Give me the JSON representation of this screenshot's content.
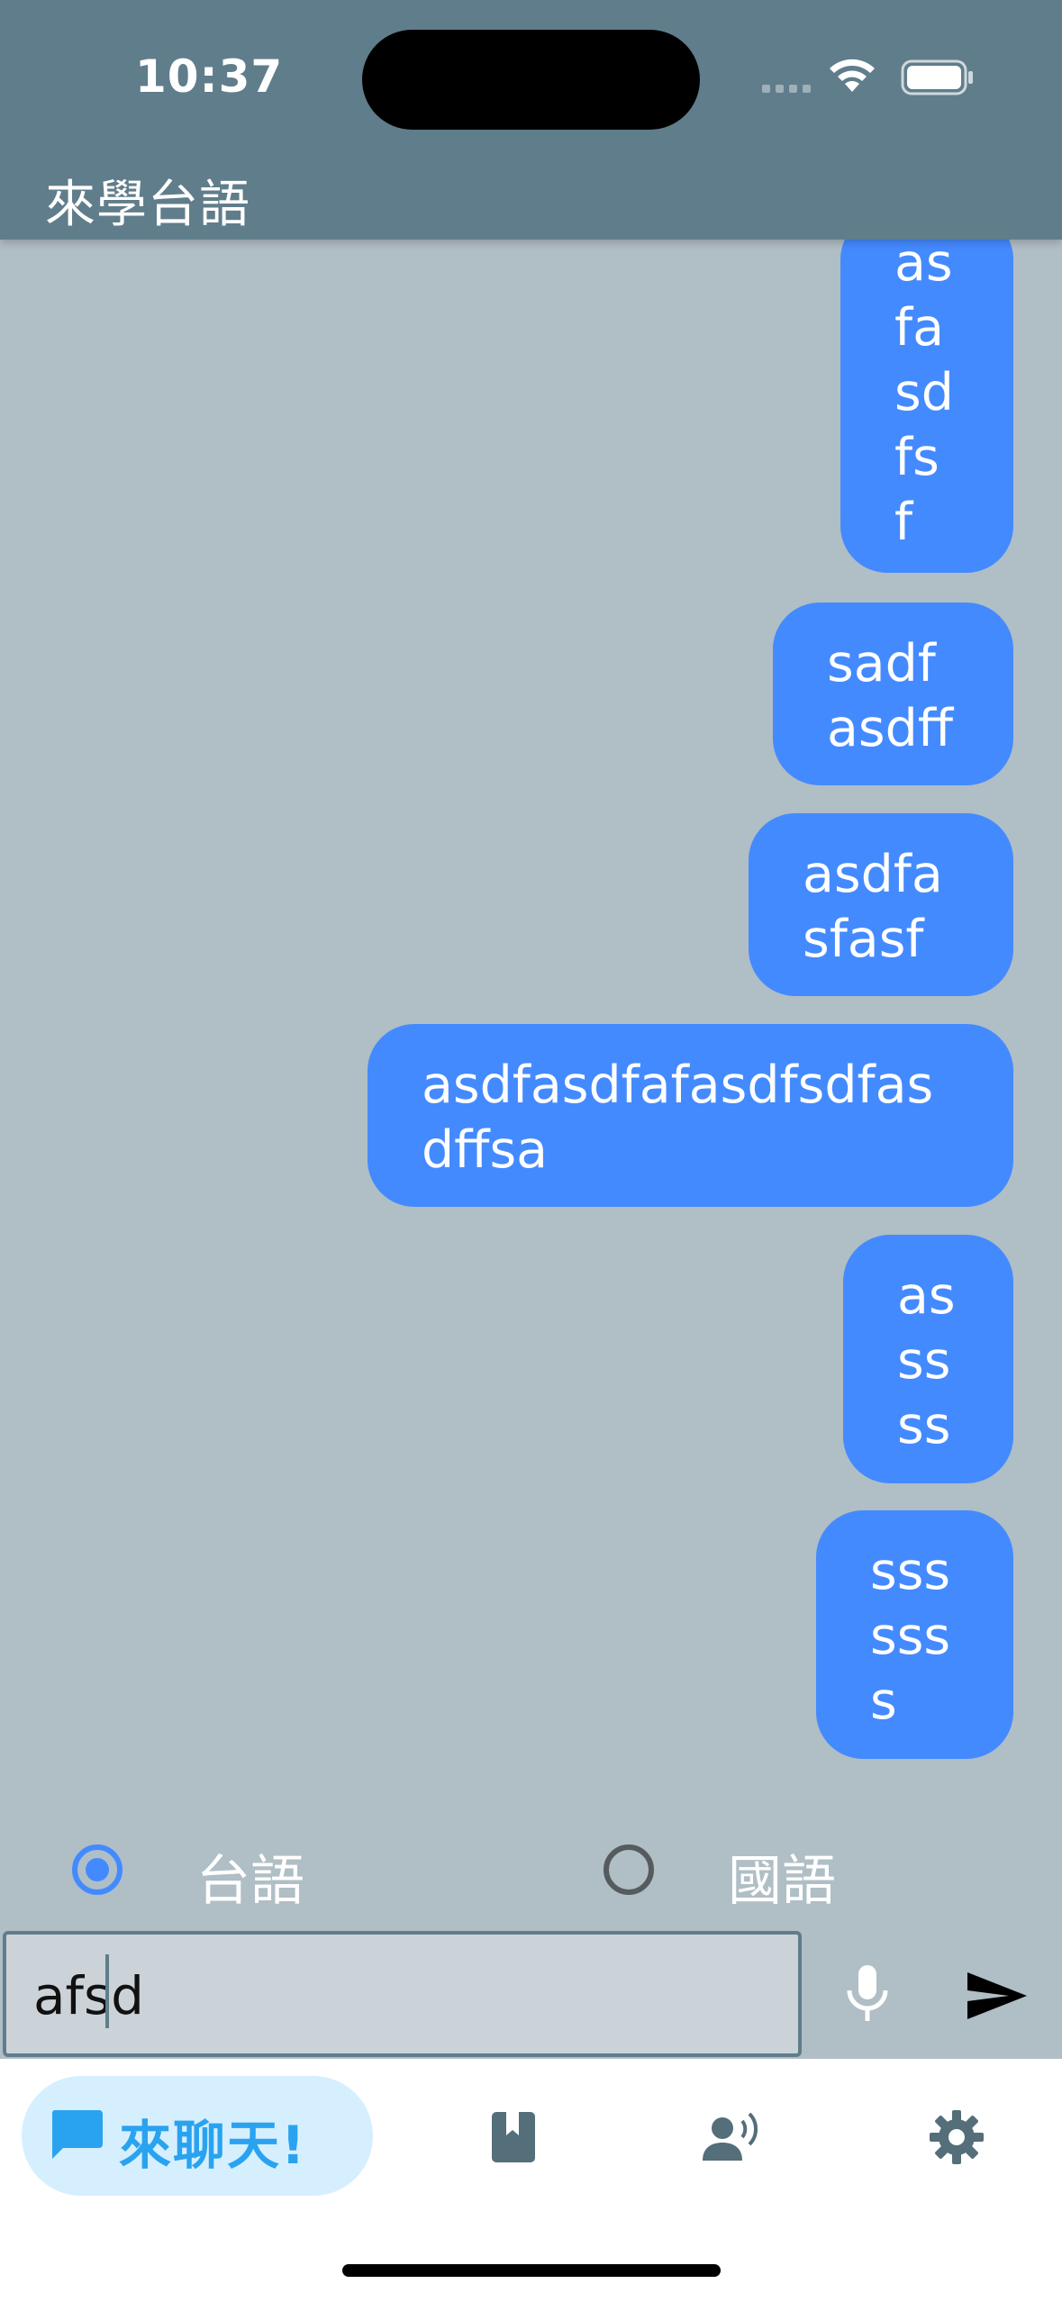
{
  "status_bar": {
    "time": "10:37"
  },
  "app_bar": {
    "title": "來學台語"
  },
  "messages": [
    {
      "text": "as\nfa\nsd\nfs\nf"
    },
    {
      "text": "sadf\nasdff"
    },
    {
      "text": "asdfa\nsfasf"
    },
    {
      "text": "asdfasdfafasdfsdfas\ndffsa"
    },
    {
      "text": "as\nss\nss"
    },
    {
      "text": "sss\nsss\ns"
    }
  ],
  "language_options": [
    {
      "label": "台語",
      "selected": true
    },
    {
      "label": "國語",
      "selected": false
    }
  ],
  "composer": {
    "value": "afsd"
  },
  "bottom_nav": {
    "items": [
      {
        "label": "來聊天!",
        "icon": "chat-bubble-icon",
        "active": true
      },
      {
        "icon": "book-icon",
        "active": false
      },
      {
        "icon": "voice-person-icon",
        "active": false
      },
      {
        "icon": "gear-icon",
        "active": false
      }
    ]
  },
  "colors": {
    "app_bar": "#607d8b",
    "chat_background": "#b0bec5",
    "bubble": "#448aff",
    "nav_active_bg": "#d6efff",
    "nav_active_text": "#29a3f0",
    "nav_icon": "#546e7a"
  }
}
